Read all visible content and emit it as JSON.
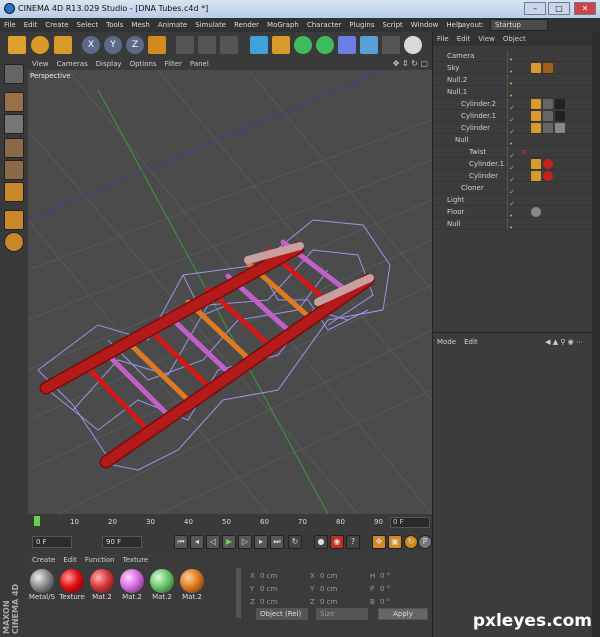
{
  "window": {
    "title": "CINEMA 4D R13.029 Studio - [DNA Tubes.c4d *]"
  },
  "menu": [
    "File",
    "Edit",
    "Create",
    "Select",
    "Tools",
    "Mesh",
    "Animate",
    "Simulate",
    "Render",
    "MoGraph",
    "Character",
    "Plugins",
    "Script",
    "Window",
    "Help"
  ],
  "layout": {
    "label": "Layout:",
    "value": "Startup"
  },
  "viewport": {
    "menu": [
      "View",
      "Cameras",
      "Display",
      "Options",
      "Filter",
      "Panel"
    ],
    "name": "Perspective"
  },
  "timeline": {
    "ticks": [
      "0",
      "10",
      "20",
      "30",
      "40",
      "50",
      "60",
      "70",
      "80",
      "90"
    ],
    "current": "0 F"
  },
  "playback": {
    "start": "0 F",
    "end": "90 F"
  },
  "material_manager": {
    "menu": [
      "Create",
      "Edit",
      "Function",
      "Texture"
    ],
    "materials": [
      {
        "label": "Metal/S",
        "color": "#8a8a8a"
      },
      {
        "label": "Texture",
        "color": "#e01010"
      },
      {
        "label": "Mat.2",
        "color": "#d43a3a"
      },
      {
        "label": "Mat.2",
        "color": "#d56ee0"
      },
      {
        "label": "Mat.2",
        "color": "#6cc46c"
      },
      {
        "label": "Mat.2",
        "color": "#e07a20"
      }
    ]
  },
  "coordinates": {
    "rows": [
      {
        "a": "X",
        "av": "0 cm",
        "b": "X",
        "bv": "0 cm",
        "c": "H",
        "cv": "0 °"
      },
      {
        "a": "Y",
        "av": "0 cm",
        "b": "Y",
        "bv": "0 cm",
        "c": "P",
        "cv": "0 °"
      },
      {
        "a": "Z",
        "av": "0 cm",
        "b": "Z",
        "bv": "0 cm",
        "c": "B",
        "cv": "0 °"
      }
    ],
    "mode": "Object (Rel)",
    "size": "Size",
    "apply": "Apply"
  },
  "object_manager": {
    "menu": [
      "File",
      "Edit",
      "View",
      "Object"
    ],
    "objects": [
      {
        "name": "Camera"
      },
      {
        "name": "Sky"
      },
      {
        "name": "Null.2"
      },
      {
        "name": "Null.1"
      },
      {
        "name": "Cylinder.2"
      },
      {
        "name": "Cylinder.1"
      },
      {
        "name": "Cylinder"
      },
      {
        "name": "Null"
      },
      {
        "name": "Twist"
      },
      {
        "name": "Cylinder.1"
      },
      {
        "name": "Cylinder"
      },
      {
        "name": "Cloner"
      },
      {
        "name": "Light"
      },
      {
        "name": "Floor"
      },
      {
        "name": "Null"
      }
    ]
  },
  "attribute_manager": {
    "menu": [
      "Mode",
      "Edit"
    ]
  },
  "branding": {
    "maxon": "MAXON CINEMA 4D",
    "watermark": "pxleyes.com"
  },
  "colors": {
    "accent": "#e89a2a",
    "rail": "#b41a1a",
    "wire": "#9b93e8"
  }
}
